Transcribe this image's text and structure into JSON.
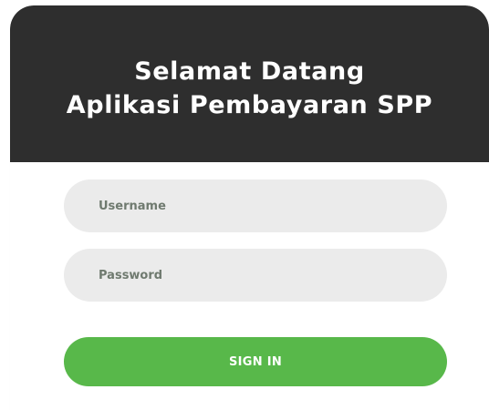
{
  "header": {
    "title_line1": "Selamat Datang",
    "title_line2": "Aplikasi Pembayaran SPP"
  },
  "form": {
    "username": {
      "placeholder": "Username",
      "value": ""
    },
    "password": {
      "placeholder": "Password",
      "value": ""
    },
    "submit_label": "SIGN IN"
  },
  "colors": {
    "header_bg": "#2e2e2e",
    "field_bg": "#ebebeb",
    "button_bg": "#58b84a",
    "placeholder_text": "#6f7a6f"
  }
}
